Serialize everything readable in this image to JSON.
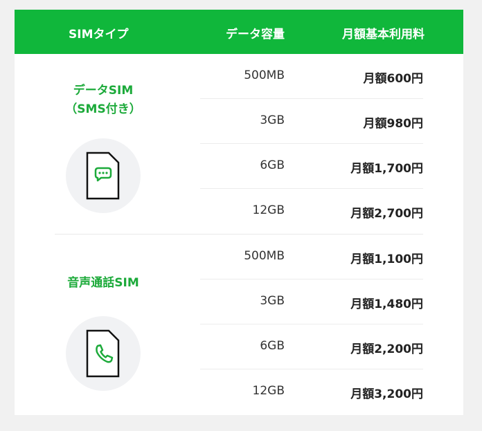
{
  "header": {
    "sim_type": "SIMタイプ",
    "data_capacity": "データ容量",
    "monthly_fee": "月額基本利用料"
  },
  "plans": [
    {
      "name_line1": "データSIM",
      "name_line2": "（SMS付き）",
      "icon": "sim-card-message-icon",
      "rows": [
        {
          "capacity": "500MB",
          "price": "月額600円"
        },
        {
          "capacity": "3GB",
          "price": "月額980円"
        },
        {
          "capacity": "6GB",
          "price": "月額1,700円"
        },
        {
          "capacity": "12GB",
          "price": "月額2,700円"
        }
      ]
    },
    {
      "name_line1": "音声通話SIM",
      "icon": "sim-card-phone-icon",
      "rows": [
        {
          "capacity": "500MB",
          "price": "月額1,100円"
        },
        {
          "capacity": "3GB",
          "price": "月額1,480円"
        },
        {
          "capacity": "6GB",
          "price": "月額2,200円"
        },
        {
          "capacity": "12GB",
          "price": "月額3,200円"
        }
      ]
    }
  ],
  "colors": {
    "header_bg": "#10b73b",
    "plan_name": "#1caa3a",
    "icon_bg": "#f1f2f4",
    "background": "#f1f1f1"
  }
}
